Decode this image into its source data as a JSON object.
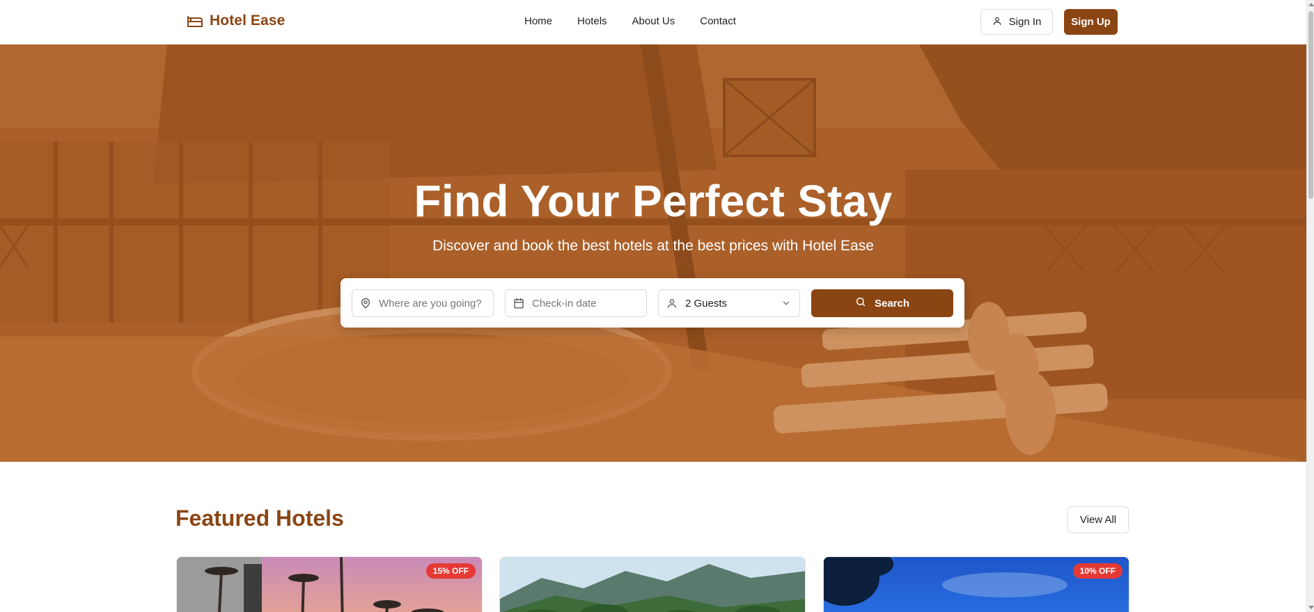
{
  "brand": {
    "name": "Hotel Ease"
  },
  "nav": {
    "items": [
      "Home",
      "Hotels",
      "About Us",
      "Contact"
    ]
  },
  "auth": {
    "signin_label": "Sign In",
    "signup_label": "Sign Up"
  },
  "hero": {
    "title": "Find Your Perfect Stay",
    "subtitle": "Discover and book the best hotels at the best prices with Hotel Ease"
  },
  "search": {
    "destination_placeholder": "Where are you going?",
    "checkin_placeholder": "Check-in date",
    "guests_value": "2 Guests",
    "search_label": "Search"
  },
  "featured": {
    "title": "Featured Hotels",
    "view_all_label": "View All",
    "cards": [
      {
        "badge": "15% OFF"
      },
      {
        "badge": ""
      },
      {
        "badge": "10% OFF"
      }
    ]
  },
  "colors": {
    "brand": "#8b4513",
    "badge": "#e53935",
    "hero_overlay": "#b86628"
  }
}
